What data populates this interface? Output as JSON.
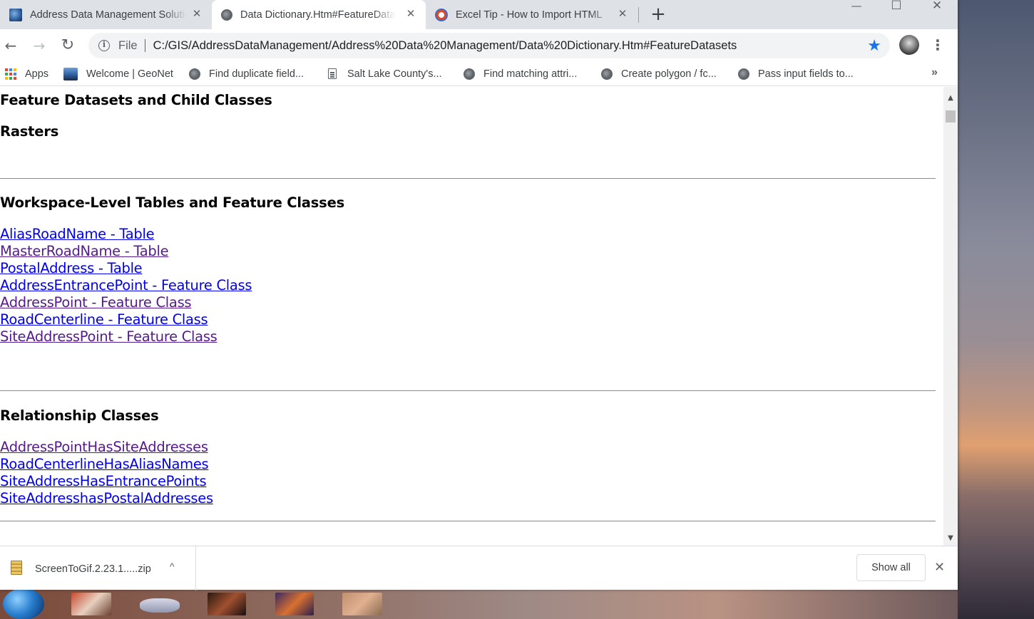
{
  "tabs": [
    {
      "title": "Address Data Management Solution",
      "active": false,
      "favicon": "arcgis-icon"
    },
    {
      "title": "Data Dictionary.Htm#FeatureDatasets",
      "active": true,
      "favicon": "globe-icon"
    },
    {
      "title": "Excel Tip - How to Import HTML",
      "active": false,
      "favicon": "excel-tip-icon"
    }
  ],
  "tab_close_glyph": "✕",
  "new_tab_glyph": "+",
  "window_controls": {
    "minimize": "—",
    "maximize": "☐",
    "close": "✕"
  },
  "toolbar": {
    "back_glyph": "←",
    "forward_glyph": "→",
    "reload_glyph": "↻",
    "scheme_label": "File",
    "url": "C:/GIS/AddressDataManagement/Address%20Data%20Management/Data%20Dictionary.Htm#FeatureDatasets",
    "star_glyph": "★",
    "menu_glyph": "⋮"
  },
  "bookmarks": [
    {
      "label": "Apps",
      "icon": "apps-grid-icon"
    },
    {
      "label": "Welcome | GeoNet",
      "icon": "geonet-icon"
    },
    {
      "label": "Find duplicate field...",
      "icon": "globe-icon"
    },
    {
      "label": "Salt Lake County's...",
      "icon": "document-icon"
    },
    {
      "label": "Find matching attri...",
      "icon": "globe-icon"
    },
    {
      "label": "Create polygon / fc...",
      "icon": "globe-icon"
    },
    {
      "label": "Pass input fields to...",
      "icon": "globe-icon"
    }
  ],
  "bookmarks_overflow": "»",
  "page": {
    "heading_feature_datasets": "Feature Datasets and Child Classes",
    "heading_rasters": "Rasters",
    "heading_workspace": "Workspace-Level Tables and Feature Classes",
    "workspace_links": [
      "AliasRoadName - Table",
      "MasterRoadName - Table",
      "PostalAddress - Table",
      "AddressEntrancePoint - Feature Class",
      "AddressPoint - Feature Class",
      "RoadCenterline - Feature Class",
      "SiteAddressPoint - Feature Class"
    ],
    "heading_relationships": "Relationship Classes",
    "relationship_links": [
      "AddressPointHasSiteAddresses",
      "RoadCenterlineHasAliasNames",
      "SiteAddressHasEntrancePoints",
      "SiteAddresshasPostalAddresses"
    ]
  },
  "scrollbar": {
    "up_glyph": "▲",
    "down_glyph": "▼"
  },
  "download_shelf": {
    "file_name": "ScreenToGif.2.23.1.....zip",
    "chevron_glyph": "^",
    "show_all_label": "Show all",
    "close_glyph": "✕"
  },
  "colors": {
    "link_visited": "#551a8b",
    "link_unvisited": "#0000ee",
    "tabstrip_bg": "#dee1e6",
    "star": "#1a73e8"
  }
}
